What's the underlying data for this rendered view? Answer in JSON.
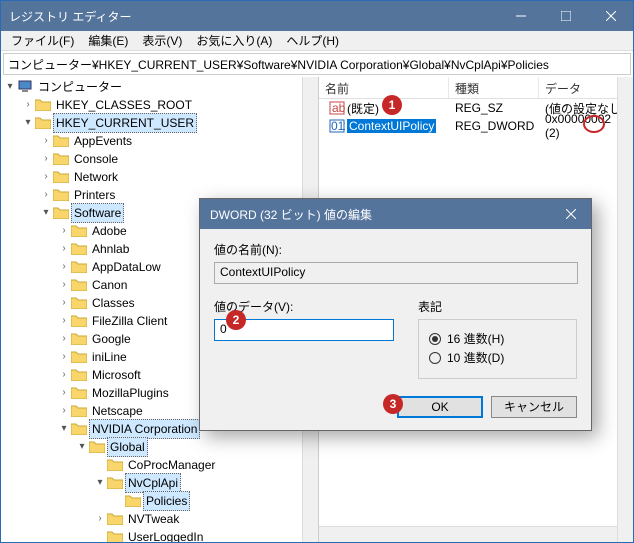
{
  "window": {
    "title": "レジストリ エディター"
  },
  "menu": {
    "file": "ファイル(F)",
    "edit": "編集(E)",
    "view": "表示(V)",
    "favorites": "お気に入り(A)",
    "help": "ヘルプ(H)"
  },
  "address": "コンピューター¥HKEY_CURRENT_USER¥Software¥NVIDIA Corporation¥Global¥NvCplApi¥Policies",
  "tree": {
    "root": "コンピューター",
    "hkcr": "HKEY_CLASSES_ROOT",
    "hkcu": "HKEY_CURRENT_USER",
    "appevents": "AppEvents",
    "console": "Console",
    "network": "Network",
    "printers": "Printers",
    "software": "Software",
    "adobe": "Adobe",
    "ahnlab": "Ahnlab",
    "appdatalow": "AppDataLow",
    "canon": "Canon",
    "classes": "Classes",
    "filezilla": "FileZilla Client",
    "google": "Google",
    "iniline": "iniLine",
    "microsoft": "Microsoft",
    "mozillaplugins": "MozillaPlugins",
    "netscape": "Netscape",
    "nvidia": "NVIDIA Corporation",
    "global": "Global",
    "coprocmanager": "CoProcManager",
    "nvcplapi": "NvCplApi",
    "policies": "Policies",
    "nvtweak": "NVTweak",
    "userloggedin": "UserLoggedIn"
  },
  "list": {
    "headers": {
      "name": "名前",
      "type": "種類",
      "data": "データ"
    },
    "rows": [
      {
        "name": "(既定)",
        "type": "REG_SZ",
        "data": "(値の設定なし)",
        "icon": "sz"
      },
      {
        "name": "ContextUIPolicy",
        "type": "REG_DWORD",
        "data": "0x00000002 (2)",
        "icon": "dw",
        "selected": true
      }
    ]
  },
  "dialog": {
    "title": "DWORD (32 ビット) 値の編集",
    "name_label": "値の名前(N):",
    "name_value": "ContextUIPolicy",
    "data_label": "値のデータ(V):",
    "data_value": "0",
    "base_label": "表記",
    "radio_hex": "16 進数(H)",
    "radio_dec": "10 進数(D)",
    "ok": "OK",
    "cancel": "キャンセル"
  },
  "annotations": {
    "b1": "1",
    "b2": "2",
    "b3": "3"
  }
}
